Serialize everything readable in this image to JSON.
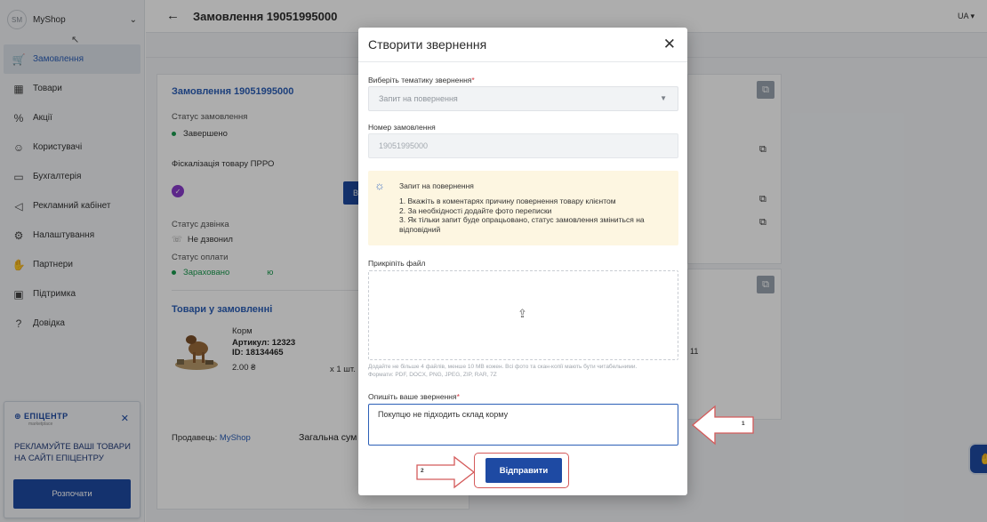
{
  "sidebar": {
    "shop_avatar": "SM",
    "shop_name": "MyShop",
    "items": [
      {
        "label": "Замовлення",
        "icon": "cart-icon"
      },
      {
        "label": "Товари",
        "icon": "box-icon"
      },
      {
        "label": "Акції",
        "icon": "discount-icon"
      },
      {
        "label": "Користувачі",
        "icon": "users-icon"
      },
      {
        "label": "Бухгалтерія",
        "icon": "wallet-icon"
      },
      {
        "label": "Рекламний кабінет",
        "icon": "megaphone-icon"
      },
      {
        "label": "Налаштування",
        "icon": "gear-icon"
      },
      {
        "label": "Партнери",
        "icon": "handshake-icon"
      },
      {
        "label": "Підтримка",
        "icon": "chat-icon"
      },
      {
        "label": "Довідка",
        "icon": "help-icon"
      }
    ]
  },
  "promo": {
    "logo": "ЕПІЦЕНТР",
    "logo_sub": "marketplace",
    "text": "РЕКЛАМУЙТЕ ВАШІ ТОВАРИ НА САЙТІ ЕПІЦЕНТРУ",
    "button": "Розпочати"
  },
  "header": {
    "title": "Замовлення 19051995000",
    "lang": "UA"
  },
  "order_card": {
    "title": "Замовлення 19051995000",
    "status_label": "Статус замовлення",
    "status_value": "Завершено",
    "fiscal_label": "Фіскалізація товару ПРРО",
    "call_label": "Статус дзвінка",
    "call_value": "Не дзвонил",
    "payment_label": "Статус оплати",
    "payment_value": "Зараховано",
    "payment_suffix": "ю",
    "goods_title": "Товари у замовленні",
    "product_name": "Корм",
    "product_sku": "Артикул: 12323",
    "product_id": "ID: 18134465",
    "product_price": "2.00 ₴",
    "product_qty": "x 1 шт.",
    "seller_label": "Продавець:",
    "seller_name": "MyShop",
    "total_label": "Загальна сум",
    "behind_num": "11",
    "status_color": "#1a9b4f"
  },
  "modal": {
    "title": "Створити звернення",
    "topic_label": "Виберіть тематику звернення",
    "topic_placeholder": "Запит на повернення",
    "order_label": "Номер замовлення",
    "order_value": "19051995000",
    "info_title": "Запит на повернення",
    "info_line1": "1. Вкажіть в коментарях причину повернення товару клієнтом",
    "info_line2": "2. За необхідності додайте фото переписки",
    "info_line3": "3. Як тільки запит буде опрацьовано, статус замовлення зміниться на відповідний",
    "attach_label": "Прикріпіть файл",
    "attach_hint": "Додайте не більше 4 файлів, менше 10 MB кожен. Всі фото та скан-копії мають бути читабельними. Формати: PDF, DOCX, PNG, JPEG, ZIP, RAR, 7Z",
    "desc_label": "Опишіть ваше звернення",
    "desc_value": "Покупцю не підходить склад корму",
    "submit": "Відправити",
    "required_mark": "*"
  },
  "annotations": {
    "arrow1_num": "1",
    "arrow2_num": "2",
    "color": "#d45a5a"
  },
  "colors": {
    "brand": "#1e4aa3",
    "link": "#2c5fb7",
    "success": "#1a9b4f"
  }
}
